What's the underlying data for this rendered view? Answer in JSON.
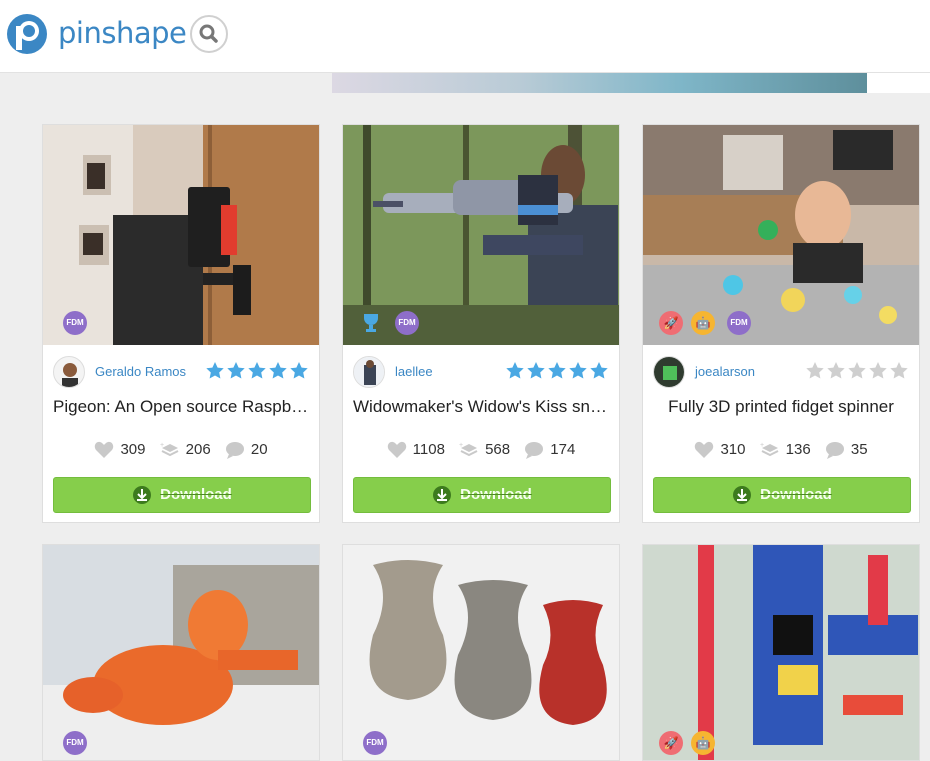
{
  "header": {
    "brand": "pinshape"
  },
  "cards": [
    {
      "author": "Geraldo Ramos",
      "rating": 5,
      "title": "Pigeon: An Open source Raspberry Pi security camera",
      "likes": "309",
      "remixes": "206",
      "comments": "20",
      "download_label": "Download",
      "badges": [
        "FDM"
      ]
    },
    {
      "author": "laellee",
      "rating": 5,
      "title": "Widowmaker's Widow's Kiss sniper rifle",
      "likes": "1108",
      "remixes": "568",
      "comments": "174",
      "download_label": "Download",
      "badges": [
        "trophy-icon",
        "FDM"
      ]
    },
    {
      "author": "joealarson",
      "rating": 0,
      "title": "Fully 3D printed fidget spinner",
      "likes": "310",
      "remixes": "136",
      "comments": "35",
      "download_label": "Download",
      "badges": [
        "rocket-icon",
        "robot-icon",
        "FDM"
      ]
    }
  ],
  "bottom_cards": [
    {
      "badges": [
        "FDM"
      ]
    },
    {
      "badges": [
        "FDM"
      ]
    },
    {
      "badges": [
        "rocket-icon",
        "robot-icon"
      ]
    }
  ],
  "colors": {
    "brand": "#3b87c4",
    "download": "#86ce4b",
    "star_filled": "#4aa8e3",
    "star_empty": "#cfcfcf",
    "fdm": "#8e6ec9"
  }
}
